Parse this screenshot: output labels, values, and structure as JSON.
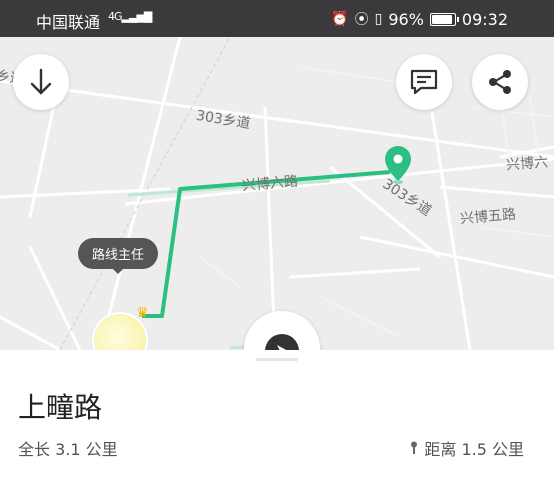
{
  "status_bar": {
    "carrier": "中国联通",
    "network": "4G",
    "battery": "96%",
    "time": "09:32",
    "icons": [
      "alarm-icon",
      "location-icon",
      "vibrate-icon",
      "battery-icon"
    ]
  },
  "map": {
    "labels": {
      "road_303_top": "303乡道",
      "road_303_right": "303乡道",
      "xingbo_6": "兴博六路",
      "xingbo_6_right": "兴博六",
      "xingbo_5": "兴博五路",
      "edge_left": "乡道"
    },
    "route_color": "#2bbf82",
    "pin_color": "#2bbf82",
    "route_tooltip": "路线主任"
  },
  "sheet": {
    "road_name": "上疃路",
    "length_text": "全长 3.1 公里",
    "distance_text": "距离 1.5 公里"
  }
}
